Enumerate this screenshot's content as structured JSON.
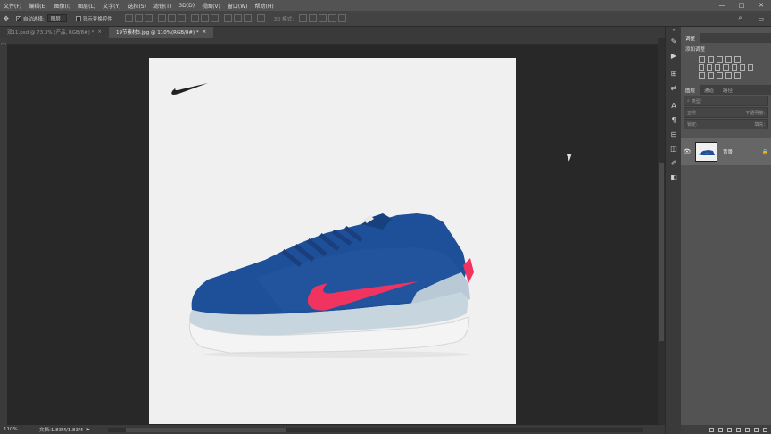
{
  "menu": [
    "文件(F)",
    "编辑(E)",
    "图像(I)",
    "图层(L)",
    "文字(Y)",
    "选择(S)",
    "滤镜(T)",
    "3D(D)",
    "视图(V)",
    "窗口(W)",
    "帮助(H)"
  ],
  "window_controls": [
    "—",
    "□",
    "✕"
  ],
  "options": {
    "auto_select_label": "自动选择:",
    "auto_select_value": "图层",
    "show_transform_label": "显示变换控件",
    "mode_3d_label": "3D 模式:"
  },
  "tabs": [
    {
      "label": "双11.psd @ 73.3% (产品, RGB/8#) *",
      "active": false
    },
    {
      "label": "19节素材3.jpg @ 110%(RGB/8#) *",
      "active": true
    }
  ],
  "status": {
    "zoom": "110%",
    "doc": "文档:1.83M/1.83M"
  },
  "right_panel": {
    "top_tabs": [
      "调整"
    ],
    "adjust_title": "添加调整",
    "layer_tabs": [
      "图层",
      "通道",
      "路径"
    ],
    "filter_placeholder": "类型",
    "blend_mode": "正常",
    "opacity_label": "不透明度:",
    "lock_label": "锁定:",
    "fill_label": "填充:",
    "layer_name": "背景"
  },
  "colors": {
    "shoe_blue": "#1e4f99",
    "swoosh_pink": "#f0335f",
    "sole_white": "#f4f4f4",
    "canvas_bg": "#f0f0f0"
  }
}
